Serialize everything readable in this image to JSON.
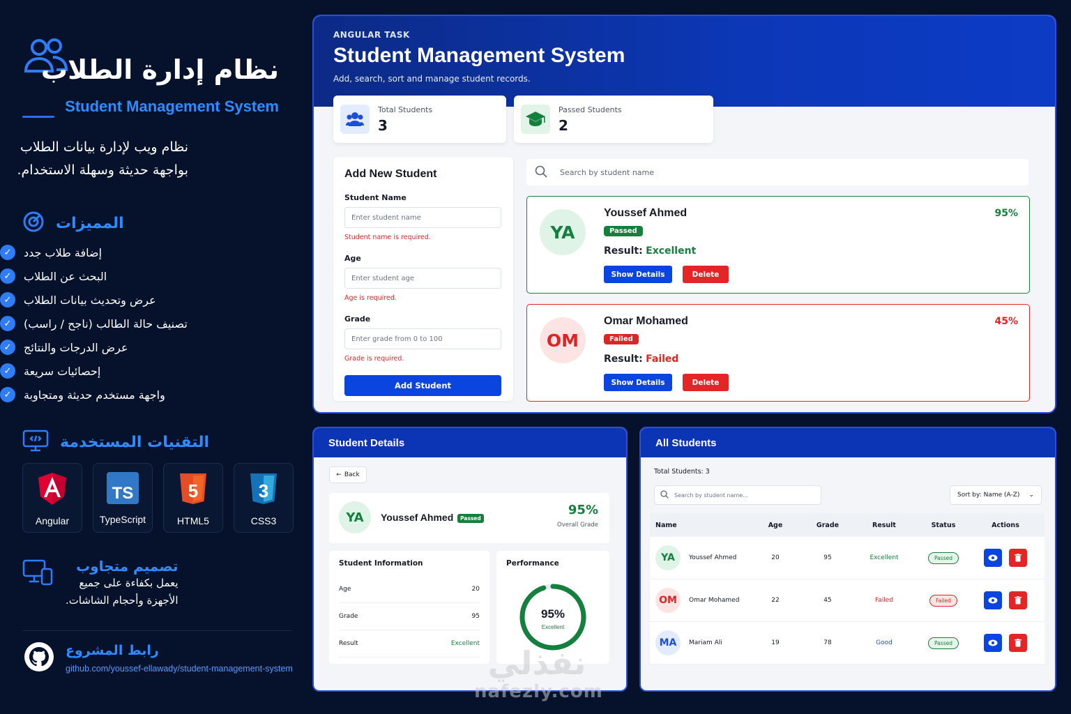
{
  "left": {
    "title_ar": "نظام إدارة الطلاب",
    "title_en": "Student Management System",
    "intro": "نظام ويب لإدارة بيانات الطلاب بواجهة حديثة وسهلة الاستخدام.",
    "features_title": "المميزات",
    "features": [
      "إضافة طلاب جدد",
      "البحث عن الطلاب",
      "عرض وتحديث بيانات الطلاب",
      "تصنيف حالة الطالب (ناجح / راسب)",
      "عرض الدرجات والنتائج",
      "إحصائيات سريعة",
      "واجهة مستخدم حديثة ومتجاوبة"
    ],
    "tech_title": "التقنيات المستخدمة",
    "techs": [
      "Angular",
      "TypeScript",
      "HTML5",
      "CSS3"
    ],
    "responsive_title": "تصميم متجاوب",
    "responsive_desc_1": "يعمل بكفاءة على جميع",
    "responsive_desc_2": "الأجهزة وأحجام الشاشات.",
    "repo_title": "رابط المشروع",
    "repo_url": "github.com/youssef-ellawady/student-management-system"
  },
  "hero": {
    "tag": "ANGULAR TASK",
    "title": "Student Management System",
    "subtitle": "Add, search, sort and manage student records."
  },
  "stats": [
    {
      "label": "Total Students",
      "value": "3"
    },
    {
      "label": "Passed Students",
      "value": "2"
    }
  ],
  "form": {
    "title": "Add New Student",
    "name_label": "Student Name",
    "name_placeholder": "Enter student name",
    "name_error": "Student name is required.",
    "age_label": "Age",
    "age_placeholder": "Enter student age",
    "age_error": "Age is required.",
    "grade_label": "Grade",
    "grade_placeholder": "Enter grade from 0 to 100",
    "grade_error": "Grade is required.",
    "submit": "Add Student"
  },
  "search": {
    "placeholder": "Search by student name"
  },
  "cards": [
    {
      "initials": "YA",
      "name": "Youssef Ahmed",
      "status": "Passed",
      "result_label": "Result:",
      "result": "Excellent",
      "percent": "95%",
      "show": "Show Details",
      "delete": "Delete",
      "accent": "#15803d",
      "bg": "#dff3e6"
    },
    {
      "initials": "OM",
      "name": "Omar Mohamed",
      "status": "Failed",
      "result_label": "Result:",
      "result": "Failed",
      "percent": "45%",
      "show": "Show Details",
      "delete": "Delete",
      "accent": "#e02424",
      "bg": "#fde4e4"
    }
  ],
  "details": {
    "header": "Student Details",
    "back": "Back",
    "initials": "YA",
    "name": "Youssef Ahmed",
    "badge": "Passed",
    "percent": "95%",
    "overall": "Overall Grade",
    "info_title": "Student Information",
    "rows": [
      {
        "k": "Age",
        "v": "20"
      },
      {
        "k": "Grade",
        "v": "95"
      },
      {
        "k": "Result",
        "v": "Excellent"
      }
    ],
    "perf_title": "Performance",
    "perf_value": "95%",
    "perf_progress": 0.95,
    "perf_label": "Excellent"
  },
  "all": {
    "header": "All Students",
    "total": "Total Students: 3",
    "search_placeholder": "Search by student name...",
    "sort": "Sort by: Name (A-Z)",
    "columns": [
      "Name",
      "Age",
      "Grade",
      "Result",
      "Status",
      "Actions"
    ],
    "rows": [
      {
        "initials": "YA",
        "name": "Youssef Ahmed",
        "age": "20",
        "grade": "95",
        "result": "Excellent",
        "status": "Passed"
      },
      {
        "initials": "OM",
        "name": "Omar Mohamed",
        "age": "22",
        "grade": "45",
        "result": "Failed",
        "status": "Failed"
      },
      {
        "initials": "MA",
        "name": "Mariam Ali",
        "age": "19",
        "grade": "78",
        "result": "Good",
        "status": "Passed"
      }
    ]
  },
  "watermark": {
    "ar": "نفذلي",
    "en": "nafezly.com"
  },
  "colors": {
    "primary": "#0a45e0",
    "passed": "#15803d",
    "failed": "#e02424",
    "accent_text": "#2f8cff"
  }
}
